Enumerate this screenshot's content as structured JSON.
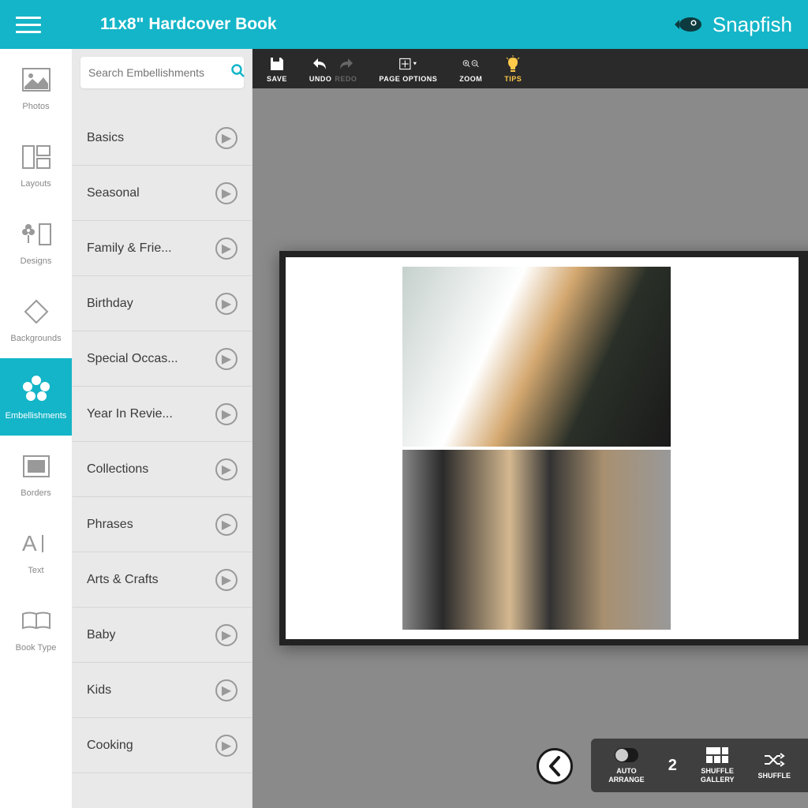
{
  "header": {
    "title": "11x8\" Hardcover Book",
    "brand": "Snapfish"
  },
  "nav": {
    "items": [
      {
        "key": "photos",
        "label": "Photos"
      },
      {
        "key": "layouts",
        "label": "Layouts"
      },
      {
        "key": "designs",
        "label": "Designs"
      },
      {
        "key": "backgrounds",
        "label": "Backgrounds"
      },
      {
        "key": "embellishments",
        "label": "Embellishments",
        "active": true
      },
      {
        "key": "borders",
        "label": "Borders"
      },
      {
        "key": "text",
        "label": "Text"
      },
      {
        "key": "booktype",
        "label": "Book Type"
      }
    ]
  },
  "search": {
    "placeholder": "Search Embellishments"
  },
  "categories": [
    "Basics",
    "Seasonal",
    "Family & Frie...",
    "Birthday",
    "Special Occas...",
    "Year In Revie...",
    "Collections",
    "Phrases",
    "Arts & Crafts",
    "Baby",
    "Kids",
    "Cooking"
  ],
  "toolbar": {
    "save": "SAVE",
    "undo": "UNDO",
    "redo": "REDO",
    "pageoptions": "PAGE OPTIONS",
    "zoom": "ZOOM",
    "tips": "TIPS"
  },
  "bottom": {
    "auto": "AUTO ARRANGE",
    "page": "2",
    "shufflegallery": "SHUFFLE GALLERY",
    "shuffle": "SHUFFLE"
  }
}
